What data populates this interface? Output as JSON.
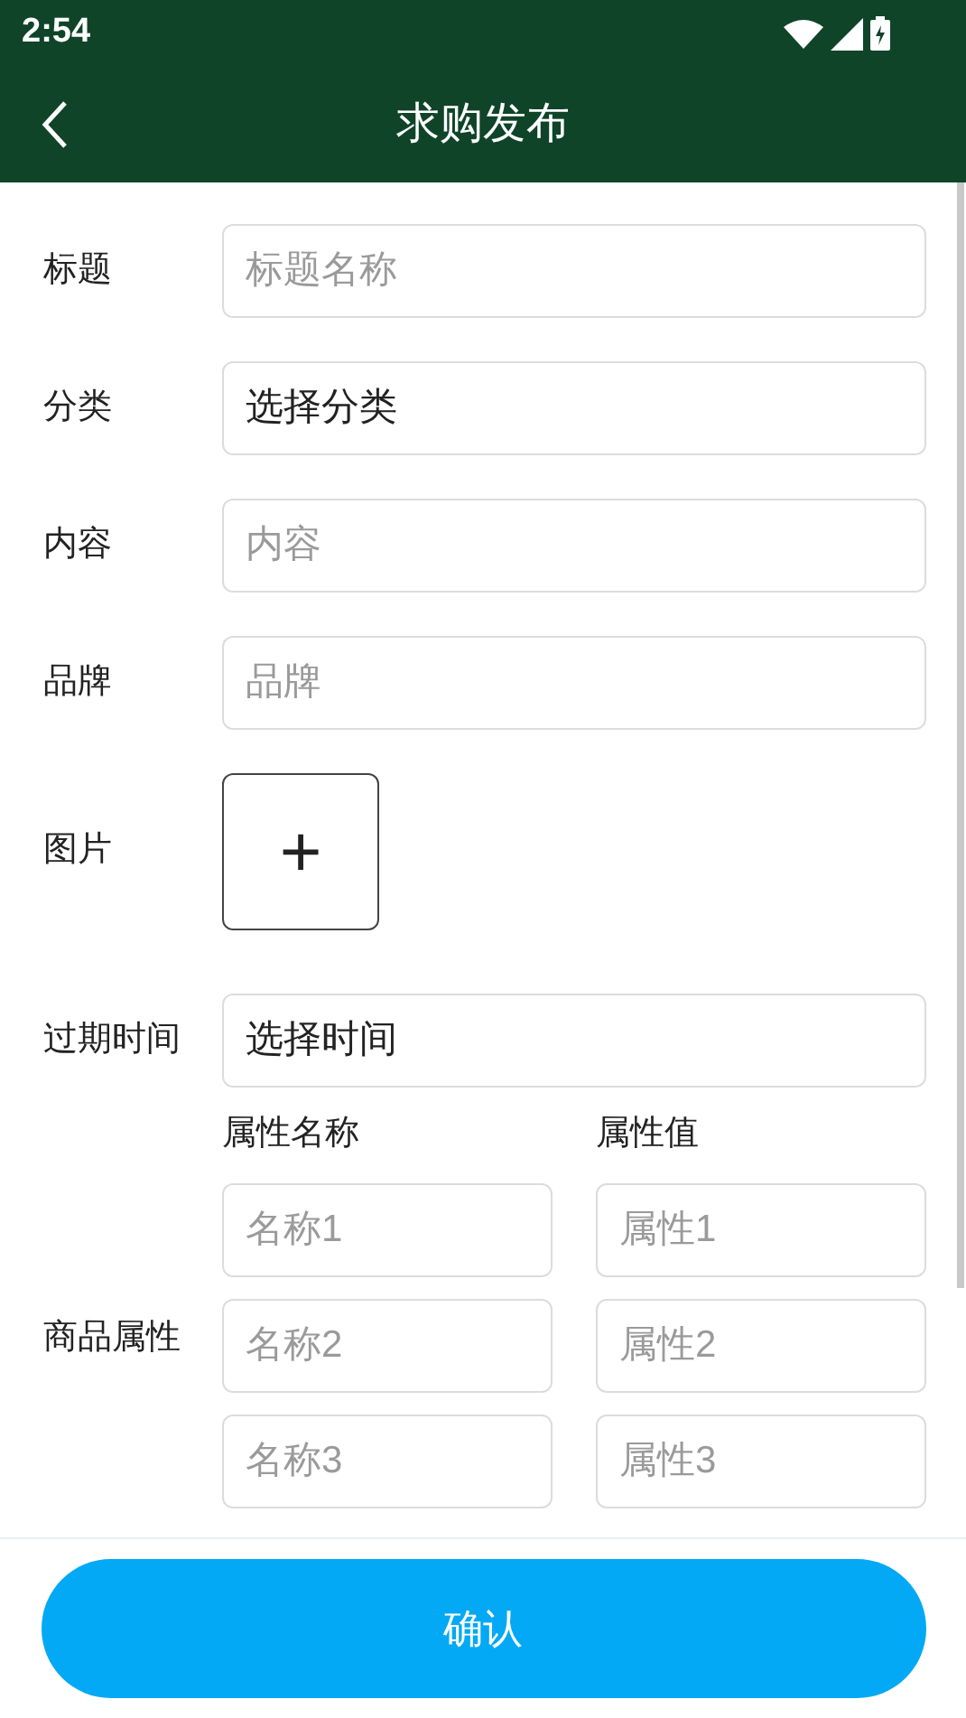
{
  "status_bar": {
    "time": "2:54"
  },
  "header": {
    "title": "求购发布"
  },
  "fields": [
    {
      "label": "标题",
      "kind": "input",
      "placeholder": "标题名称"
    },
    {
      "label": "分类",
      "kind": "select",
      "value": "选择分类"
    },
    {
      "label": "内容",
      "kind": "input",
      "placeholder": "内容"
    },
    {
      "label": "品牌",
      "kind": "input",
      "placeholder": "品牌"
    },
    {
      "label": "图片",
      "kind": "image",
      "add_symbol": "+"
    },
    {
      "label": "过期时间",
      "kind": "select",
      "value": "选择时间"
    }
  ],
  "attributes": {
    "label": "商品属性",
    "name_heading": "属性名称",
    "value_heading": "属性值",
    "rows": [
      {
        "name_placeholder": "名称1",
        "value_placeholder": "属性1"
      },
      {
        "name_placeholder": "名称2",
        "value_placeholder": "属性2"
      },
      {
        "name_placeholder": "名称3",
        "value_placeholder": "属性3"
      }
    ]
  },
  "confirm_button": "确认"
}
